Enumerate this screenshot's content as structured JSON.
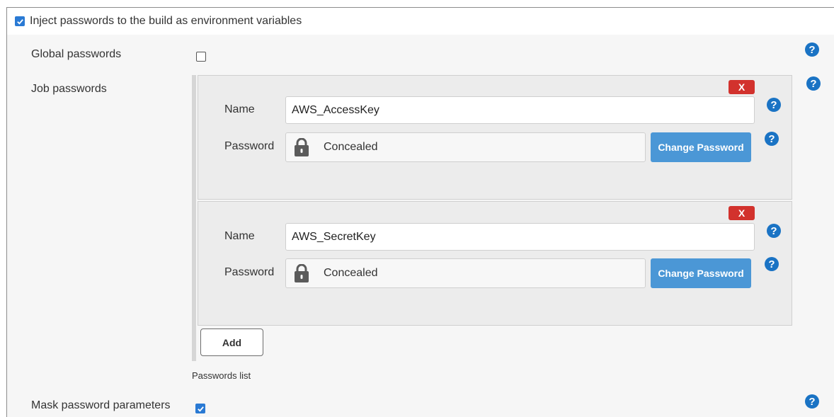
{
  "header": {
    "inject_label": "Inject passwords to the build as environment variables",
    "inject_checked": true
  },
  "global_passwords": {
    "label": "Global passwords",
    "checked": false
  },
  "job_passwords": {
    "label": "Job passwords",
    "entries": [
      {
        "delete_label": "X",
        "name_label": "Name",
        "name_value": "AWS_AccessKey",
        "password_label": "Password",
        "password_value": "Concealed",
        "change_label": "Change Password"
      },
      {
        "delete_label": "X",
        "name_label": "Name",
        "name_value": "AWS_SecretKey",
        "password_label": "Password",
        "password_value": "Concealed",
        "change_label": "Change Password"
      }
    ],
    "add_label": "Add",
    "list_note": "Passwords list"
  },
  "mask": {
    "label": "Mask password parameters",
    "checked": true
  },
  "help_glyph": "?",
  "icons": {
    "help": "help-icon",
    "lock": "lock-icon",
    "check": "checkmark-icon"
  },
  "colors": {
    "accent": "#1a73c4",
    "danger": "#d2322d",
    "button": "#4b97d6"
  }
}
